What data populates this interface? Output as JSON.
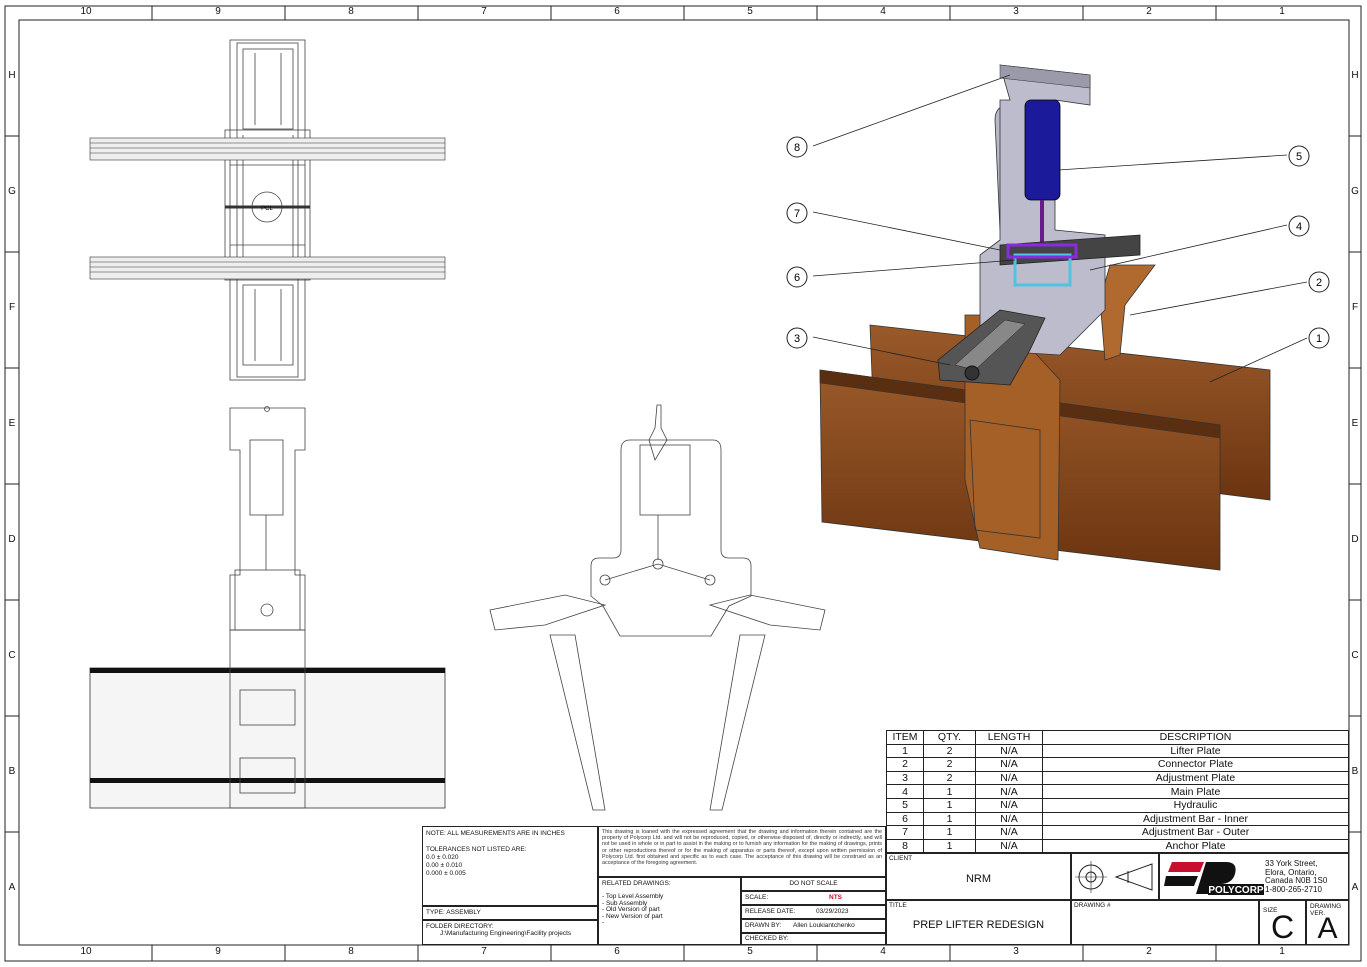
{
  "zones": {
    "columns": [
      "10",
      "9",
      "8",
      "7",
      "6",
      "5",
      "4",
      "3",
      "2",
      "1"
    ],
    "rows": [
      "H",
      "G",
      "F",
      "E",
      "D",
      "C",
      "B",
      "A"
    ]
  },
  "balloons": [
    {
      "num": "8"
    },
    {
      "num": "7"
    },
    {
      "num": "6"
    },
    {
      "num": "3"
    },
    {
      "num": "5"
    },
    {
      "num": "4"
    },
    {
      "num": "2"
    },
    {
      "num": "1"
    }
  ],
  "views": {
    "center_logo": "PCL"
  },
  "bom": {
    "headers": [
      "ITEM",
      "QTY.",
      "LENGTH",
      "DESCRIPTION"
    ],
    "rows": [
      {
        "item": "1",
        "qty": "2",
        "length": "N/A",
        "description": "Lifter Plate"
      },
      {
        "item": "2",
        "qty": "2",
        "length": "N/A",
        "description": "Connector Plate"
      },
      {
        "item": "3",
        "qty": "2",
        "length": "N/A",
        "description": "Adjustment Plate"
      },
      {
        "item": "4",
        "qty": "1",
        "length": "N/A",
        "description": "Main Plate"
      },
      {
        "item": "5",
        "qty": "1",
        "length": "N/A",
        "description": "Hydraulic"
      },
      {
        "item": "6",
        "qty": "1",
        "length": "N/A",
        "description": "Adjustment Bar - Inner"
      },
      {
        "item": "7",
        "qty": "1",
        "length": "N/A",
        "description": "Adjustment Bar - Outer"
      },
      {
        "item": "8",
        "qty": "1",
        "length": "N/A",
        "description": "Anchor Plate"
      }
    ]
  },
  "title_block": {
    "note": "NOTE: ALL MEASUREMENTS ARE IN INCHES",
    "tolerances_label": "TOLERANCES NOT LISTED ARE:",
    "tolerances": [
      "0.0 ± 0.020",
      "0.00 ± 0.010",
      "0.000 ± 0.005"
    ],
    "type_label": "TYPE:",
    "type_value": "ASSEMBLY",
    "folder_label": "FOLDER DIRECTORY:",
    "folder_value": "J:\\Manufacturing Engineering\\Facility projects",
    "notice": "This drawing is loaned with the expressed agreement that the drawing and information therein contained are the property of Polycorp Ltd. and will not be reproduced, copied, or otherwise disposed of, directly or indirectly, and will not be used in whole or in part to assist in the making or to furnish any information for the making of drawings, prints or other reproductions thereof or for the making of apparatus or parts thereof, except upon written permission of Polycorp Ltd. first obtained and specific as to each case. The acceptance of this drawing will be construed as an acceptance of the foregoing agreement.",
    "related_label": "RELATED DRAWINGS:",
    "related": [
      "- Top Level Assembly",
      "- Sub Assembly",
      "- Old Version of part",
      "- New Version of part",
      "-"
    ],
    "do_not_scale": "DO NOT SCALE",
    "scale_label": "SCALE:",
    "scale_value": "NTS",
    "release_label": "RELEASE DATE:",
    "release_value": "03/29/2023",
    "drawn_label": "DRAWN BY:",
    "drawn_value": "Allen Loukiantchenko",
    "checked_label": "CHECKED BY:",
    "client_label": "CLIENT",
    "client_value": "NRM",
    "title_label": "TITLE",
    "title_value": "PREP LIFTER REDESIGN",
    "drawing_no_label": "DRAWING #",
    "company": "POLYCORP",
    "address": [
      "33 York Street,",
      "Elora, Ontario,",
      "Canada N0B 1S0",
      "1-800-265-2710"
    ],
    "size_label": "SIZE",
    "size_value": "C",
    "version_label": "DRAWING VER.",
    "version_value": "A"
  },
  "colors": {
    "lifter_plate": "#8B4A1E",
    "hydraulic": "#1A1A9A",
    "plate_gray": "#B8B8C8",
    "bar_cyan": "#4FC3E0",
    "bar_purple": "#8A2BE2",
    "logo_red": "#C8102E"
  }
}
